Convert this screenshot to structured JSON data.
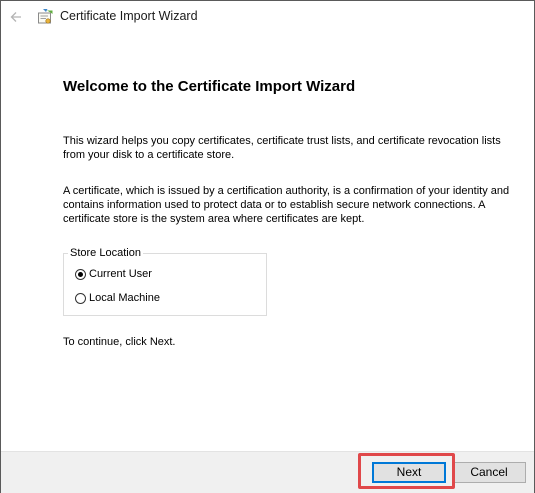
{
  "window": {
    "title": "Certificate Import Wizard",
    "icons": {
      "back": "arrow-left-icon",
      "app": "certificate-wizard-icon"
    }
  },
  "content": {
    "heading": "Welcome to the Certificate Import Wizard",
    "paragraph1": "This wizard helps you copy certificates, certificate trust lists, and certificate revocation lists from your disk to a certificate store.",
    "paragraph2": "A certificate, which is issued by a certification authority, is a confirmation of your identity and contains information used to protect data or to establish secure network connections. A certificate store is the system area where certificates are kept.",
    "store_location": {
      "label": "Store Location",
      "options": [
        {
          "label": "Current User",
          "selected": true
        },
        {
          "label": "Local Machine",
          "selected": false
        }
      ]
    },
    "continue_text": "To continue, click Next."
  },
  "footer": {
    "next_label": "Next",
    "cancel_label": "Cancel"
  },
  "colors": {
    "highlight": "#e0484a",
    "default_button_border": "#0078d7"
  }
}
